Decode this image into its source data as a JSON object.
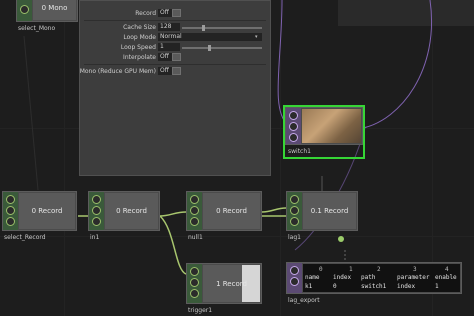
{
  "colors": {
    "selected_border": "#36d636",
    "wire": "#a8c66e",
    "wire_purple": "#9b78c9"
  },
  "top_node": {
    "viewer_value": "0 Mono",
    "name": "select_Mono"
  },
  "panel": {
    "record_label": "Record",
    "record_value": "Off",
    "cache_size_label": "Cache Size",
    "cache_size_value": "128",
    "loop_mode_label": "Loop Mode",
    "loop_mode_value": "Normal",
    "loop_speed_label": "Loop Speed",
    "loop_speed_value": "1",
    "interpolate_label": "Interpolate",
    "interpolate_value": "Off",
    "mono_label": "Mono (Reduce GPU Mem)",
    "mono_value": "Off"
  },
  "nodes": {
    "switch1": {
      "name": "switch1"
    },
    "select_record": {
      "name": "select_Record",
      "value": "0 Record"
    },
    "in1": {
      "name": "in1",
      "value": "0 Record"
    },
    "null1": {
      "name": "null1",
      "value": "0 Record"
    },
    "lag1": {
      "name": "lag1",
      "value": "0.1 Record"
    },
    "trigger1": {
      "name": "trigger1",
      "value": "1 Record"
    },
    "lag_export": {
      "name": "lag_export",
      "col_index": [
        "0",
        "1",
        "2",
        "3",
        "4"
      ],
      "header": [
        "name",
        "index",
        "path",
        "parameter",
        "enable"
      ],
      "row": [
        "k1",
        "0",
        "switch1",
        "index",
        "1"
      ]
    }
  }
}
